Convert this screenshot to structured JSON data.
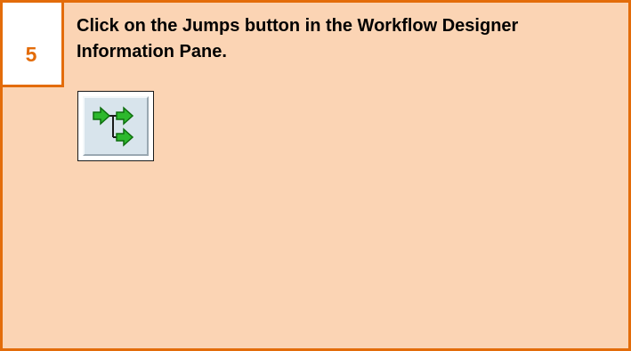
{
  "step": {
    "number": "5"
  },
  "instruction": {
    "text": "Click on the Jumps button in the Workflow Designer Information Pane."
  },
  "jumps_button": {
    "icon": "jumps-icon"
  },
  "colors": {
    "accent": "#E36C0A",
    "card_background": "#FBD4B4",
    "icon_arrow": "#2DB82D"
  }
}
